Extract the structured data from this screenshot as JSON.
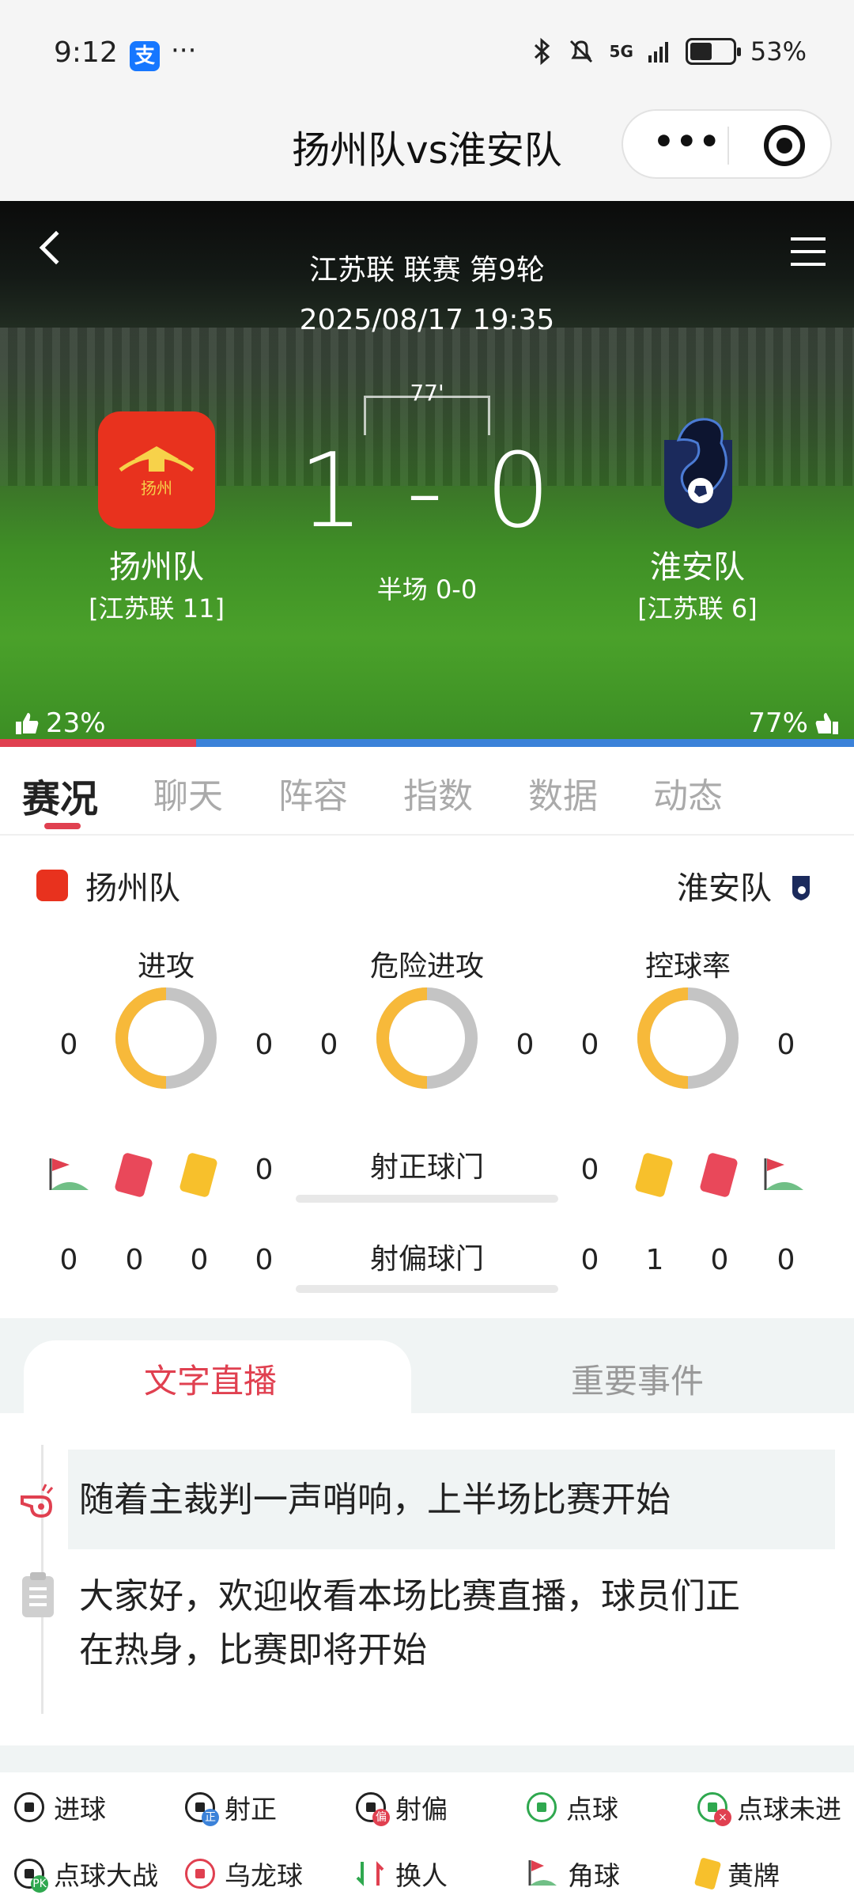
{
  "status_bar": {
    "time": "9:12",
    "alipay": "支",
    "dots": "···",
    "network": "5G",
    "battery": "53%",
    "battery_level": 0.53
  },
  "title_bar": {
    "title": "扬州队vs淮安队",
    "more": "•••"
  },
  "match": {
    "league_round": "江苏联 联赛 第9轮",
    "datetime": "2025/08/17 19:35",
    "minute": "77'",
    "score": "1 - 0",
    "halftime": "半场 0-0",
    "home": {
      "name": "扬州队",
      "rank": "[江苏联 11]",
      "logo_text": "扬州",
      "vote": "23%"
    },
    "away": {
      "name": "淮安队",
      "rank": "[江苏联 6]",
      "vote": "77%"
    },
    "home_support_fraction": 0.23,
    "colors": {
      "home": "#e04050",
      "away": "#3b82d9"
    }
  },
  "tabs": [
    "赛况",
    "聊天",
    "阵容",
    "指数",
    "数据",
    "动态"
  ],
  "stats": {
    "home_team": "扬州队",
    "away_team": "淮安队",
    "rings": [
      {
        "label": "进攻",
        "home": "0",
        "away": "0"
      },
      {
        "label": "危险进攻",
        "home": "0",
        "away": "0"
      },
      {
        "label": "控球率",
        "home": "0",
        "away": "0"
      }
    ],
    "shots_on": {
      "label": "射正球门",
      "home_yellow": "0",
      "away_yellow": "0"
    },
    "shots_off": {
      "label": "射偏球门",
      "home": [
        "0",
        "0",
        "0",
        "0"
      ],
      "away": [
        "0",
        "1",
        "0",
        "0"
      ]
    },
    "colors": {
      "ring_left": "#f7b93a",
      "ring_right": "#c4c4c4",
      "red_card": "#e9485a",
      "yellow_card": "#f7c02c"
    }
  },
  "live": {
    "tab_text": "文字直播",
    "tab_events": "重要事件",
    "feed": [
      {
        "icon": "whistle-icon",
        "text": "随着主裁判一声哨响，上半场比赛开始"
      },
      {
        "icon": "clipboard-icon",
        "line1": "大家好，欢迎收看本场比赛直播，球员们正",
        "line2": "在热身，比赛即将开始"
      }
    ]
  },
  "legend": {
    "row1": [
      "进球",
      "射正",
      "射偏",
      "点球",
      "点球未进"
    ],
    "row2": [
      "点球大战",
      "乌龙球",
      "换人",
      "角球",
      "黄牌"
    ]
  }
}
